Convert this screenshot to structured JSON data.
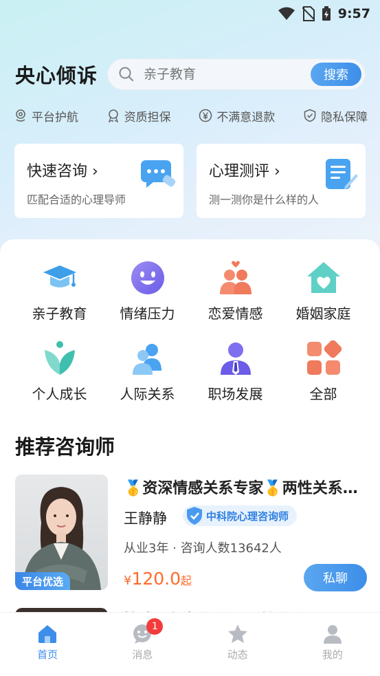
{
  "status_bar": {
    "time": "9:57"
  },
  "header": {
    "title": "央心倾诉",
    "search": {
      "placeholder": "亲子教育",
      "button_label": "搜索"
    }
  },
  "guarantees": [
    {
      "label": "平台护航",
      "icon": "location-shield-icon"
    },
    {
      "label": "资质担保",
      "icon": "medal-icon"
    },
    {
      "label": "不满意退款",
      "icon": "yuan-icon"
    },
    {
      "label": "隐私保障",
      "icon": "shield-check-icon"
    }
  ],
  "quick_cards": [
    {
      "title": "快速咨询 ›",
      "subtitle": "匹配合适的心理导师",
      "icon": "chat-bubble-icon"
    },
    {
      "title": "心理测评 ›",
      "subtitle": "测一测你是什么样的人",
      "icon": "document-pen-icon"
    }
  ],
  "categories": [
    {
      "label": "亲子教育",
      "icon": "graduation-cap-icon"
    },
    {
      "label": "情绪压力",
      "icon": "smiley-icon"
    },
    {
      "label": "恋爱情感",
      "icon": "couple-icon"
    },
    {
      "label": "婚姻家庭",
      "icon": "house-heart-icon"
    },
    {
      "label": "个人成长",
      "icon": "sprout-icon"
    },
    {
      "label": "人际关系",
      "icon": "people-icon"
    },
    {
      "label": "职场发展",
      "icon": "businessman-icon"
    },
    {
      "label": "全部",
      "icon": "grid-icon"
    }
  ],
  "section": {
    "recommend_title": "推荐咨询师"
  },
  "counselor": {
    "headline": "🥇资深情感关系专家🥇两性关系专家",
    "name": "王静静",
    "cert": "中科院心理咨询师",
    "badge": "平台优选",
    "meta": "从业3年 · 咨询人数13642人",
    "price_currency": "¥",
    "price": "120.0",
    "price_unit": "起",
    "chat_label": "私聊"
  },
  "next_counselor": {
    "headline_partial": "情感 [家庭关系] [两性关系"
  },
  "bottom_nav": {
    "items": [
      {
        "label": "首页",
        "icon": "home-icon",
        "active": true
      },
      {
        "label": "消息",
        "icon": "message-icon",
        "badge": "1"
      },
      {
        "label": "动态",
        "icon": "star-icon"
      },
      {
        "label": "我的",
        "icon": "user-icon"
      }
    ]
  },
  "colors": {
    "accent": "#3d8ee9",
    "price": "#ff6a2b",
    "badge": "#f23c3c"
  }
}
